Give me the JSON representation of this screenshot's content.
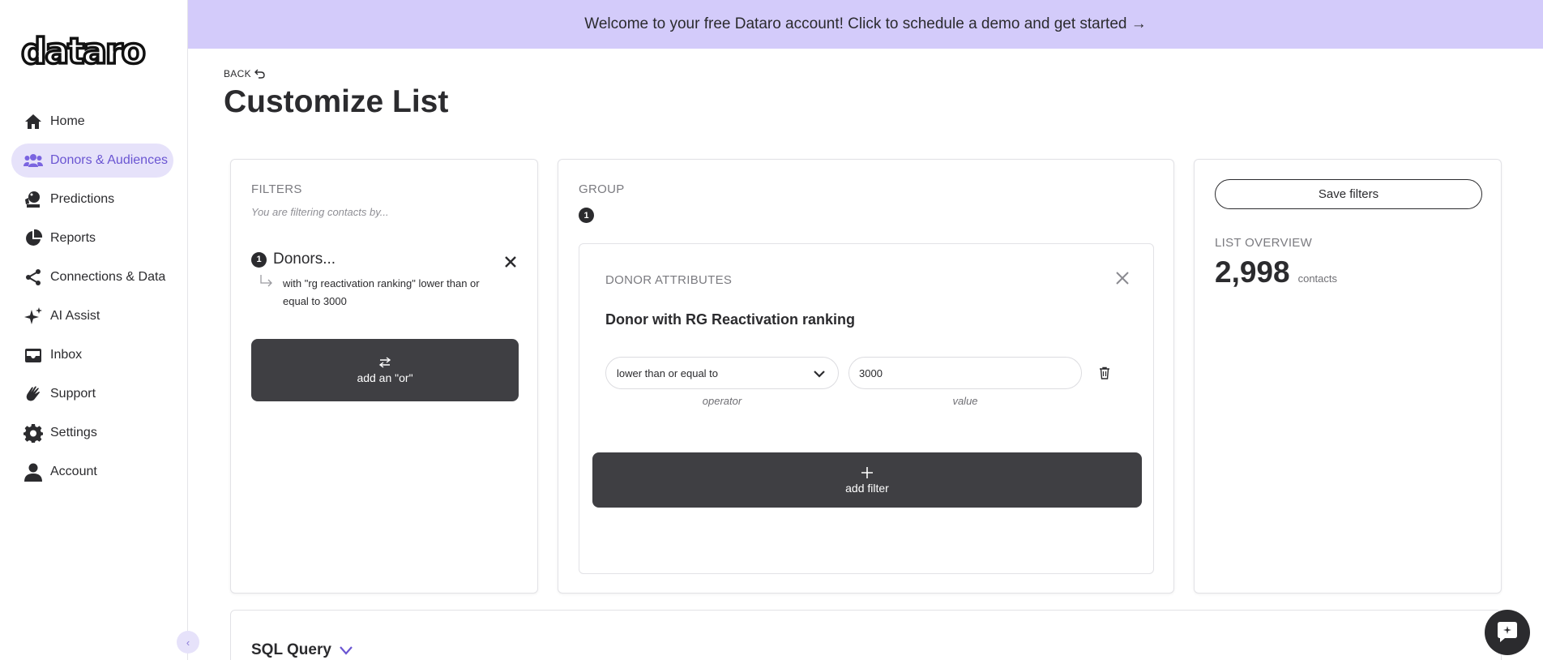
{
  "brand": {
    "logo_text": "dataro",
    "accent": "#6a55d2",
    "banner_bg": "#d3cbfa",
    "dark_button": "#3f3f43"
  },
  "sidebar": {
    "items": [
      {
        "label": "Home",
        "icon": "home-icon",
        "active": false
      },
      {
        "label": "Donors & Audiences",
        "icon": "people-icon",
        "active": true
      },
      {
        "label": "Predictions",
        "icon": "crystal-ball-icon",
        "active": false
      },
      {
        "label": "Reports",
        "icon": "pie-chart-icon",
        "active": false
      },
      {
        "label": "Connections & Data",
        "icon": "share-icon",
        "active": false
      },
      {
        "label": "AI Assist",
        "icon": "sparkles-icon",
        "active": false
      },
      {
        "label": "Inbox",
        "icon": "inbox-icon",
        "active": false
      },
      {
        "label": "Support",
        "icon": "hand-wave-icon",
        "active": false
      },
      {
        "label": "Settings",
        "icon": "gear-icon",
        "active": false
      },
      {
        "label": "Account",
        "icon": "user-icon",
        "active": false
      }
    ],
    "collapse_glyph": "‹"
  },
  "banner": {
    "text": "Welcome to your free Dataro account! Click to schedule a demo and get started →"
  },
  "header": {
    "back_label": "BACK",
    "title": "Customize List"
  },
  "filters": {
    "label": "FILTERS",
    "subtitle": "You are filtering contacts by...",
    "item": {
      "number": "1",
      "name": "Donors...",
      "description": "with \"rg reactivation ranking\" lower than or equal to 3000"
    },
    "or_button_label": "add an \"or\""
  },
  "group": {
    "label": "GROUP",
    "number": "1",
    "attributes": {
      "label": "DONOR ATTRIBUTES",
      "title": "Donor with RG Reactivation ranking",
      "operator_value": "lower than or equal to",
      "value": "3000",
      "operator_hint": "operator",
      "value_hint": "value"
    },
    "add_filter_label": "add filter"
  },
  "overview": {
    "save_label": "Save filters",
    "label": "LIST OVERVIEW",
    "count": "2,998",
    "unit": "contacts"
  },
  "sql": {
    "title": "SQL Query"
  }
}
